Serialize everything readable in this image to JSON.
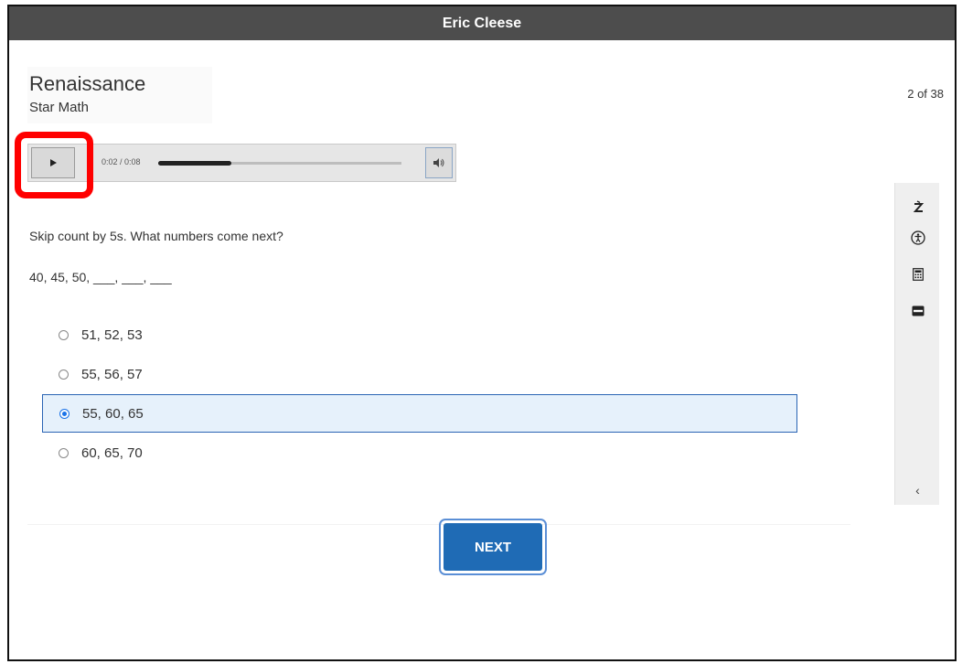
{
  "header": {
    "student_name": "Eric Cleese"
  },
  "brand": {
    "name": "Renaissance",
    "product": "Star Math"
  },
  "progress": {
    "counter": "2 of 38"
  },
  "audio_player": {
    "time_display": "0:02 / 0:08",
    "progress_fraction": 0.3,
    "play_icon": "play-icon",
    "volume_icon": "speaker-icon"
  },
  "question": {
    "prompt": "Skip count by 5s. What numbers come next?",
    "sequence": "40, 45, 50, ___, ___, ___"
  },
  "options": [
    {
      "label": "51, 52, 53",
      "selected": false
    },
    {
      "label": "55, 56, 57",
      "selected": false
    },
    {
      "label": "55, 60, 65",
      "selected": true
    },
    {
      "label": "60, 65, 70",
      "selected": false
    }
  ],
  "toolbar": {
    "tools": [
      "translate-icon",
      "accessibility-icon",
      "calculator-icon",
      "line-reader-icon"
    ],
    "collapse_icon": "chevron-left-icon",
    "collapse_glyph": "‹"
  },
  "actions": {
    "next_label": "NEXT"
  },
  "colors": {
    "titlebar_bg": "#4d4d4d",
    "accent_blue": "#1f6bb5",
    "selected_bg": "#e6f1fb",
    "highlight_red": "#ff0000"
  }
}
